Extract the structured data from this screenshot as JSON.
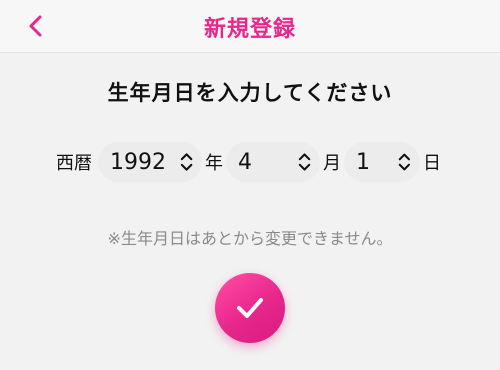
{
  "header": {
    "title": "新規登録",
    "back_icon": "chevron-left-icon"
  },
  "form": {
    "heading": "生年月日を入力してください",
    "era_label": "西暦",
    "year": {
      "value": "1992",
      "unit": "年"
    },
    "month": {
      "value": "4",
      "unit": "月"
    },
    "day": {
      "value": "1",
      "unit": "日"
    },
    "notice": "※生年月日はあとから変更できません。"
  },
  "confirm": {
    "icon": "checkmark-icon"
  },
  "colors": {
    "accent": "#e8268c",
    "background": "#f2f2f2",
    "text": "#111111",
    "muted_text": "#8a8a8a"
  }
}
